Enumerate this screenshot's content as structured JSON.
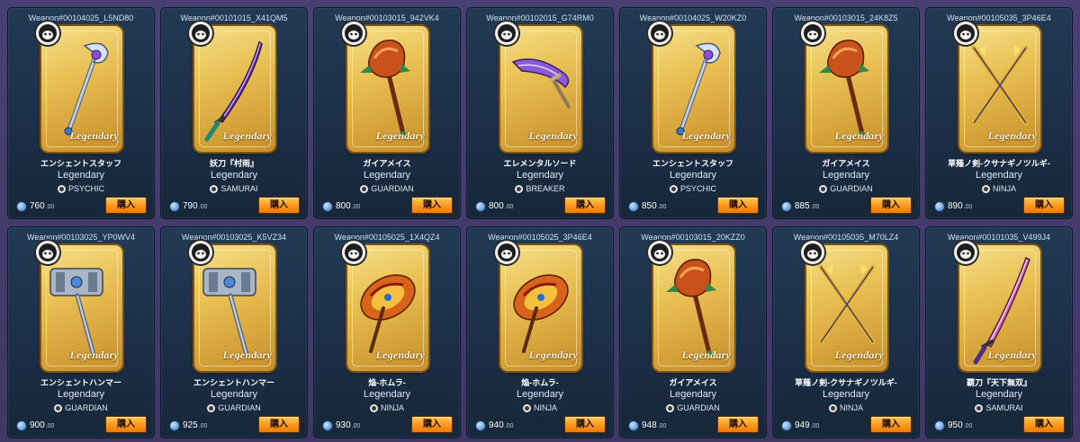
{
  "buy_label": "購入",
  "items": [
    {
      "id": "Weapon#00104025_L5ND80",
      "name": "エンシェントスタッフ",
      "rarity": "Legendary",
      "tag": "Legendary",
      "class": "PSYCHIC",
      "price": "760",
      "cents": ".00",
      "weapon_icon": "staff-icon"
    },
    {
      "id": "Weapon#00101015_X41QM5",
      "name": "妖刀『村雨』",
      "rarity": "Legendary",
      "tag": "Legendary",
      "class": "SAMURAI",
      "price": "790",
      "cents": ".00",
      "weapon_icon": "katana-icon"
    },
    {
      "id": "Weapon#00103015_942VK4",
      "name": "ガイアメイス",
      "rarity": "Legendary",
      "tag": "Legendary",
      "class": "GUARDIAN",
      "price": "800",
      "cents": ".00",
      "weapon_icon": "mace-icon"
    },
    {
      "id": "Weapon#00102015_G74RM0",
      "name": "エレメンタルソード",
      "rarity": "Legendary",
      "tag": "Legendary",
      "class": "BREAKER",
      "price": "800",
      "cents": ".00",
      "weapon_icon": "sword-icon"
    },
    {
      "id": "Weapon#00104025_W20KZ0",
      "name": "エンシェントスタッフ",
      "rarity": "Legendary",
      "tag": "Legendary",
      "class": "PSYCHIC",
      "price": "850",
      "cents": ".00",
      "weapon_icon": "staff-icon"
    },
    {
      "id": "Weapon#00103015_24K8Z5",
      "name": "ガイアメイス",
      "rarity": "Legendary",
      "tag": "Legendary",
      "class": "GUARDIAN",
      "price": "885",
      "cents": ".00",
      "weapon_icon": "mace-icon"
    },
    {
      "id": "Weapon#00105035_3P46E4",
      "name": "草薙ノ剣-クサナギノツルギ-",
      "rarity": "Legendary",
      "tag": "Legendary",
      "class": "NINJA",
      "price": "890",
      "cents": ".00",
      "weapon_icon": "crossed-blades-icon"
    },
    {
      "id": "Weapon#00103025_YP0WV4",
      "name": "エンシェントハンマー",
      "rarity": "Legendary",
      "tag": "Legendary",
      "class": "GUARDIAN",
      "price": "900",
      "cents": ".00",
      "weapon_icon": "hammer-icon"
    },
    {
      "id": "Weapon#00103025_K5VZ34",
      "name": "エンシェントハンマー",
      "rarity": "Legendary",
      "tag": "Legendary",
      "class": "GUARDIAN",
      "price": "925",
      "cents": ".00",
      "weapon_icon": "hammer-icon"
    },
    {
      "id": "Weapon#00105025_1X4QZ4",
      "name": "焔-ホムラ-",
      "rarity": "Legendary",
      "tag": "Legendary",
      "class": "NINJA",
      "price": "930",
      "cents": ".00",
      "weapon_icon": "flame-blade-icon"
    },
    {
      "id": "Weapon#00105025_3P46E4",
      "name": "焔-ホムラ-",
      "rarity": "Legendary",
      "tag": "Legendary",
      "class": "NINJA",
      "price": "940",
      "cents": ".00",
      "weapon_icon": "flame-blade-icon"
    },
    {
      "id": "Weapon#00103015_20KZZ0",
      "name": "ガイアメイス",
      "rarity": "Legendary",
      "tag": "Legendary",
      "class": "GUARDIAN",
      "price": "948",
      "cents": ".00",
      "weapon_icon": "mace-icon"
    },
    {
      "id": "Weapon#00105035_M70LZ4",
      "name": "草薙ノ剣-クサナギノツルギ-",
      "rarity": "Legendary",
      "tag": "Legendary",
      "class": "NINJA",
      "price": "949",
      "cents": ".00",
      "weapon_icon": "crossed-blades-icon"
    },
    {
      "id": "Weapon#00101035_V499J4",
      "name": "覇刀『天下無双』",
      "rarity": "Legendary",
      "tag": "Legendary",
      "class": "SAMURAI",
      "price": "950",
      "cents": ".00",
      "weapon_icon": "great-katana-icon"
    }
  ]
}
